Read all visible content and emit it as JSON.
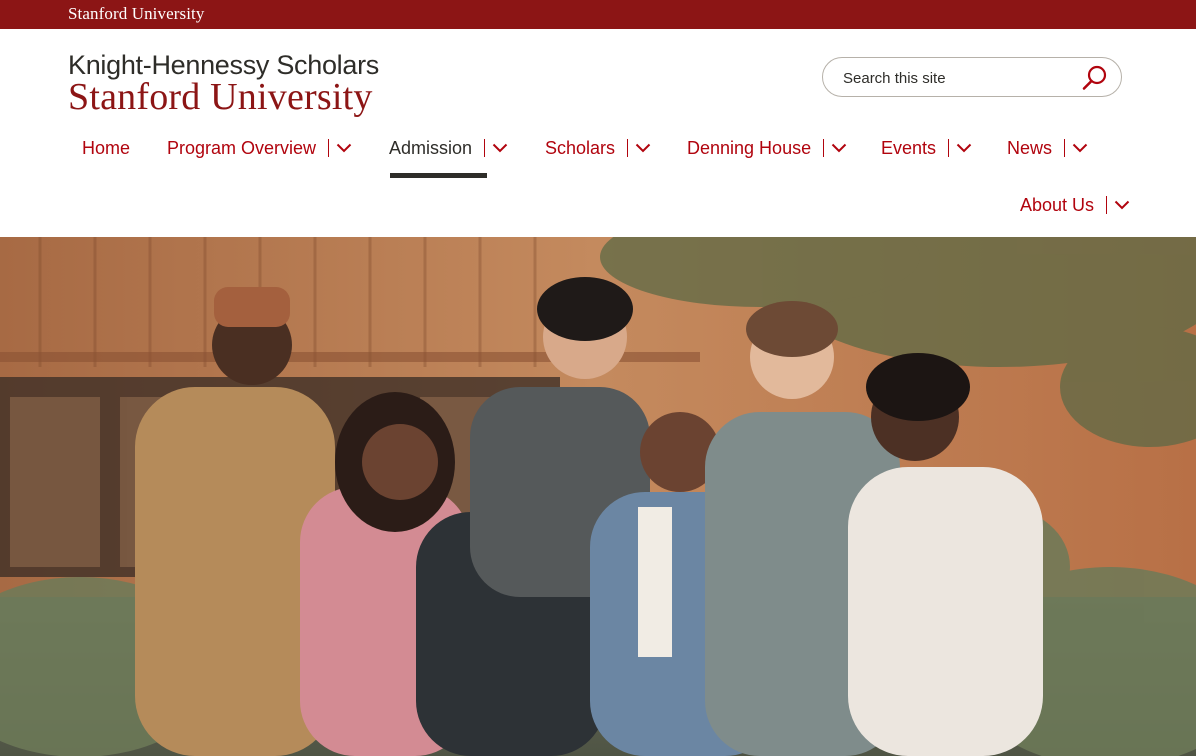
{
  "brand_bar": {
    "label": "Stanford University"
  },
  "lockup": {
    "program_name": "Knight-Hennessy Scholars",
    "university_name": "Stanford University"
  },
  "search": {
    "placeholder": "Search this site",
    "value": "",
    "icon": "search-icon"
  },
  "nav": {
    "items": [
      {
        "label": "Home",
        "has_dropdown": false,
        "active": false
      },
      {
        "label": "Program Overview",
        "has_dropdown": true,
        "active": false
      },
      {
        "label": "Admission",
        "has_dropdown": true,
        "active": true
      },
      {
        "label": "Scholars",
        "has_dropdown": true,
        "active": false
      },
      {
        "label": "Denning House",
        "has_dropdown": true,
        "active": false
      },
      {
        "label": "Events",
        "has_dropdown": true,
        "active": false
      },
      {
        "label": "News",
        "has_dropdown": true,
        "active": false
      },
      {
        "label": "About Us",
        "has_dropdown": true,
        "active": false
      }
    ],
    "dropdown_icon": "chevron-down-icon"
  },
  "hero": {
    "image": "group-photo-of-scholars"
  },
  "colors": {
    "brand": "#8c1515",
    "nav_link": "#b1040e",
    "text_dark": "#2e2d29",
    "white": "#ffffff"
  }
}
